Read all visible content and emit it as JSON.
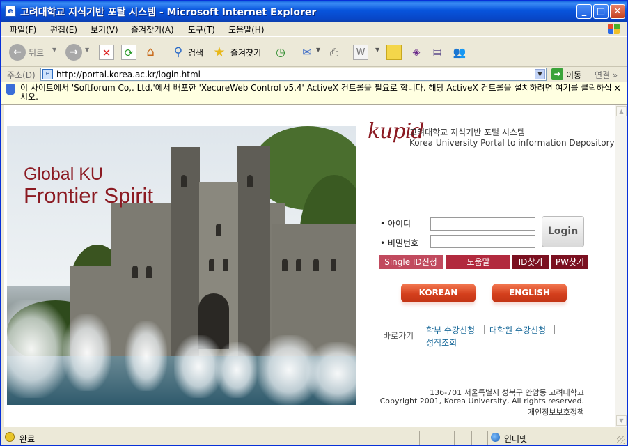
{
  "window": {
    "title": "고려대학교 지식기반 포탈 시스템 - Microsoft Internet Explorer",
    "controls": {
      "minimize": "_",
      "maximize": "□",
      "close": "✕"
    }
  },
  "menu": [
    "파일(F)",
    "편집(E)",
    "보기(V)",
    "즐겨찾기(A)",
    "도구(T)",
    "도움말(H)"
  ],
  "toolbar": {
    "back_label": "뒤로",
    "search_label": "검색",
    "favorites_label": "즐겨찾기"
  },
  "address": {
    "label": "주소(D)",
    "url": "http://portal.korea.ac.kr/login.html",
    "go_label": "이동",
    "links_label": "연결",
    "links_chevron": "»"
  },
  "infobar": {
    "message": "이 사이트에서 'Softforum Co,. Ltd.'에서 배포한 'XecureWeb Control v5.4' ActiveX 컨트롤을 필요로 합니다. 해당 ActiveX 컨트롤을 설치하려면 여기를 클릭하십시오.",
    "close": "✕"
  },
  "page": {
    "slogan_line1": "Global KU",
    "slogan_line2": "Frontier Spirit",
    "logo_text": "kupid",
    "logo_line1": "고려대학교 지식기반 포털 시스템",
    "logo_line2": "Korea University Portal to information Depository",
    "id_label": "• 아이디",
    "pw_label": "• 비밀번호",
    "id_value": "",
    "pw_value": "",
    "login_label": "Login",
    "buttons": {
      "single_id": "Single ID신청",
      "help": "도움말",
      "find_id": "ID찾기",
      "find_pw": "PW찾기"
    },
    "lang_korean": "KOREAN",
    "lang_english": "ENGLISH",
    "quick_label": "바로가기",
    "quick_links": [
      "학부 수강신청",
      "대학원 수강신청",
      "성적조회"
    ],
    "quick_sep": "|",
    "footer_address": "136-701 서울특별시 성북구 안암동 고려대학교",
    "footer_copyright": "Copyright 2001, Korea University, All rights reserved.",
    "footer_privacy": "개인정보보호정책"
  },
  "status": {
    "text": "완료",
    "zone": "인터넷"
  },
  "colors": {
    "brand": "#8b1a22",
    "single_id_btn": "#c14a5e",
    "help_btn": "#b22a3e",
    "find_btn": "#7b1020",
    "lang_btn": "#d4401d",
    "link": "#1a6a9a"
  }
}
